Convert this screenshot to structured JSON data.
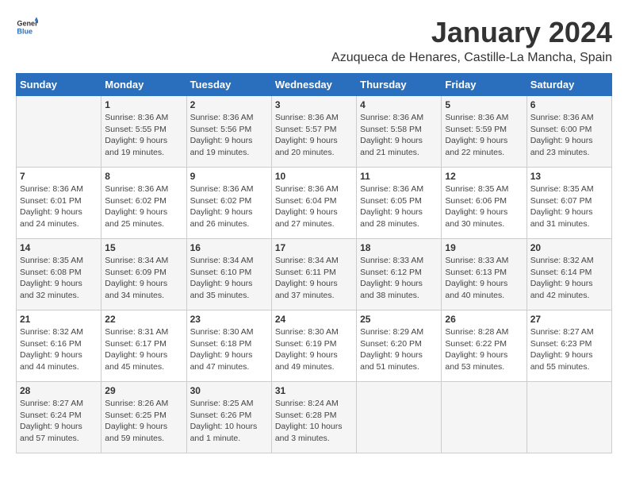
{
  "logo": {
    "general": "General",
    "blue": "Blue"
  },
  "title": "January 2024",
  "location": "Azuqueca de Henares, Castille-La Mancha, Spain",
  "weekdays": [
    "Sunday",
    "Monday",
    "Tuesday",
    "Wednesday",
    "Thursday",
    "Friday",
    "Saturday"
  ],
  "weeks": [
    [
      {
        "day": "",
        "content": ""
      },
      {
        "day": "1",
        "content": "Sunrise: 8:36 AM\nSunset: 5:55 PM\nDaylight: 9 hours\nand 19 minutes."
      },
      {
        "day": "2",
        "content": "Sunrise: 8:36 AM\nSunset: 5:56 PM\nDaylight: 9 hours\nand 19 minutes."
      },
      {
        "day": "3",
        "content": "Sunrise: 8:36 AM\nSunset: 5:57 PM\nDaylight: 9 hours\nand 20 minutes."
      },
      {
        "day": "4",
        "content": "Sunrise: 8:36 AM\nSunset: 5:58 PM\nDaylight: 9 hours\nand 21 minutes."
      },
      {
        "day": "5",
        "content": "Sunrise: 8:36 AM\nSunset: 5:59 PM\nDaylight: 9 hours\nand 22 minutes."
      },
      {
        "day": "6",
        "content": "Sunrise: 8:36 AM\nSunset: 6:00 PM\nDaylight: 9 hours\nand 23 minutes."
      }
    ],
    [
      {
        "day": "7",
        "content": "Sunrise: 8:36 AM\nSunset: 6:01 PM\nDaylight: 9 hours\nand 24 minutes."
      },
      {
        "day": "8",
        "content": "Sunrise: 8:36 AM\nSunset: 6:02 PM\nDaylight: 9 hours\nand 25 minutes."
      },
      {
        "day": "9",
        "content": "Sunrise: 8:36 AM\nSunset: 6:02 PM\nDaylight: 9 hours\nand 26 minutes."
      },
      {
        "day": "10",
        "content": "Sunrise: 8:36 AM\nSunset: 6:04 PM\nDaylight: 9 hours\nand 27 minutes."
      },
      {
        "day": "11",
        "content": "Sunrise: 8:36 AM\nSunset: 6:05 PM\nDaylight: 9 hours\nand 28 minutes."
      },
      {
        "day": "12",
        "content": "Sunrise: 8:35 AM\nSunset: 6:06 PM\nDaylight: 9 hours\nand 30 minutes."
      },
      {
        "day": "13",
        "content": "Sunrise: 8:35 AM\nSunset: 6:07 PM\nDaylight: 9 hours\nand 31 minutes."
      }
    ],
    [
      {
        "day": "14",
        "content": "Sunrise: 8:35 AM\nSunset: 6:08 PM\nDaylight: 9 hours\nand 32 minutes."
      },
      {
        "day": "15",
        "content": "Sunrise: 8:34 AM\nSunset: 6:09 PM\nDaylight: 9 hours\nand 34 minutes."
      },
      {
        "day": "16",
        "content": "Sunrise: 8:34 AM\nSunset: 6:10 PM\nDaylight: 9 hours\nand 35 minutes."
      },
      {
        "day": "17",
        "content": "Sunrise: 8:34 AM\nSunset: 6:11 PM\nDaylight: 9 hours\nand 37 minutes."
      },
      {
        "day": "18",
        "content": "Sunrise: 8:33 AM\nSunset: 6:12 PM\nDaylight: 9 hours\nand 38 minutes."
      },
      {
        "day": "19",
        "content": "Sunrise: 8:33 AM\nSunset: 6:13 PM\nDaylight: 9 hours\nand 40 minutes."
      },
      {
        "day": "20",
        "content": "Sunrise: 8:32 AM\nSunset: 6:14 PM\nDaylight: 9 hours\nand 42 minutes."
      }
    ],
    [
      {
        "day": "21",
        "content": "Sunrise: 8:32 AM\nSunset: 6:16 PM\nDaylight: 9 hours\nand 44 minutes."
      },
      {
        "day": "22",
        "content": "Sunrise: 8:31 AM\nSunset: 6:17 PM\nDaylight: 9 hours\nand 45 minutes."
      },
      {
        "day": "23",
        "content": "Sunrise: 8:30 AM\nSunset: 6:18 PM\nDaylight: 9 hours\nand 47 minutes."
      },
      {
        "day": "24",
        "content": "Sunrise: 8:30 AM\nSunset: 6:19 PM\nDaylight: 9 hours\nand 49 minutes."
      },
      {
        "day": "25",
        "content": "Sunrise: 8:29 AM\nSunset: 6:20 PM\nDaylight: 9 hours\nand 51 minutes."
      },
      {
        "day": "26",
        "content": "Sunrise: 8:28 AM\nSunset: 6:22 PM\nDaylight: 9 hours\nand 53 minutes."
      },
      {
        "day": "27",
        "content": "Sunrise: 8:27 AM\nSunset: 6:23 PM\nDaylight: 9 hours\nand 55 minutes."
      }
    ],
    [
      {
        "day": "28",
        "content": "Sunrise: 8:27 AM\nSunset: 6:24 PM\nDaylight: 9 hours\nand 57 minutes."
      },
      {
        "day": "29",
        "content": "Sunrise: 8:26 AM\nSunset: 6:25 PM\nDaylight: 9 hours\nand 59 minutes."
      },
      {
        "day": "30",
        "content": "Sunrise: 8:25 AM\nSunset: 6:26 PM\nDaylight: 10 hours\nand 1 minute."
      },
      {
        "day": "31",
        "content": "Sunrise: 8:24 AM\nSunset: 6:28 PM\nDaylight: 10 hours\nand 3 minutes."
      },
      {
        "day": "",
        "content": ""
      },
      {
        "day": "",
        "content": ""
      },
      {
        "day": "",
        "content": ""
      }
    ]
  ]
}
